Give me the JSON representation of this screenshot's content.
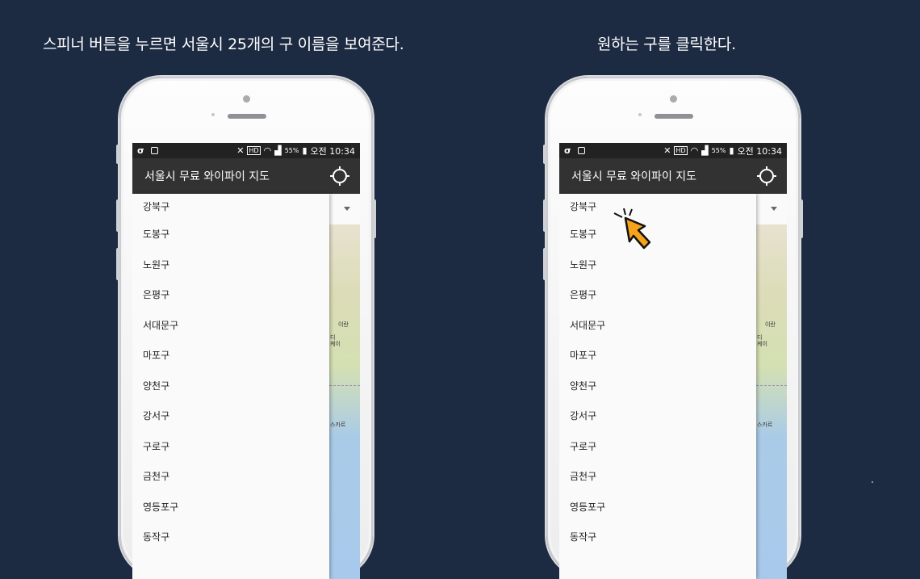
{
  "captions": {
    "left": "스피너 버튼을 누르면 서울시 25개의 구 이름을 보여준다.",
    "right": "원하는 구를 클릭한다."
  },
  "status_bar": {
    "battery": "55%",
    "time": "오전 10:34",
    "hd": "HD"
  },
  "app_bar": {
    "title": "서울시 무료 와이파이 지도"
  },
  "map_labels": [
    "이란",
    "디",
    "케이",
    "스카르"
  ],
  "districts": [
    "강북구",
    "도봉구",
    "노원구",
    "은평구",
    "서대문구",
    "마포구",
    "양천구",
    "강서구",
    "구로구",
    "금천구",
    "영등포구",
    "동작구"
  ],
  "colors": {
    "background": "#1c2a42",
    "app_bar": "#333232",
    "status_bar": "#222222",
    "cursor": "#f7a21b"
  },
  "icons": [
    "locate-icon",
    "pointer-cursor-icon",
    "mute-icon",
    "wifi-icon",
    "signal-icon",
    "battery-icon"
  ]
}
